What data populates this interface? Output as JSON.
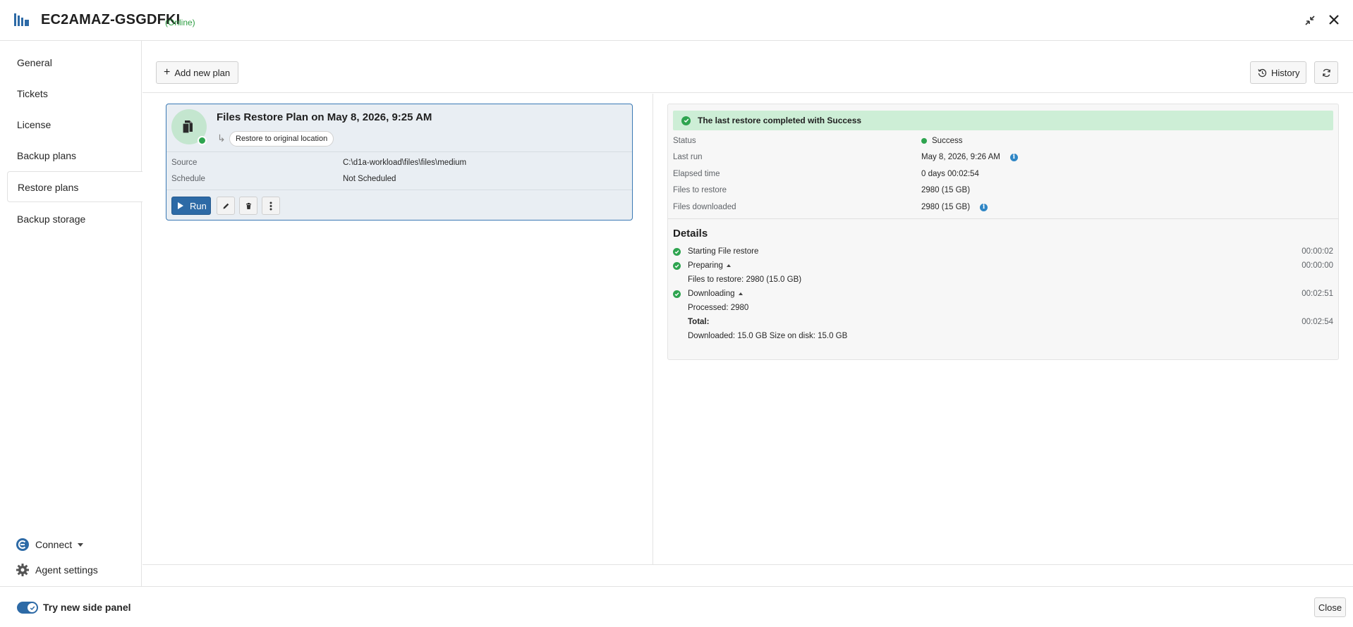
{
  "header": {
    "title": "EC2AMAZ-GSGDFKI",
    "status": "(Online)",
    "icons": [
      "app-logo-icon",
      "collapse-icon",
      "close-icon"
    ]
  },
  "sidebar": {
    "items": [
      {
        "label": "General"
      },
      {
        "label": "Tickets"
      },
      {
        "label": "License"
      },
      {
        "label": "Backup plans"
      },
      {
        "label": "Restore plans",
        "active": true
      },
      {
        "label": "Backup storage"
      }
    ],
    "connect_label": "Connect",
    "agent_settings_label": "Agent settings"
  },
  "toolbar": {
    "add_plan_label": "Add new plan",
    "history_label": "History"
  },
  "plan": {
    "name": "Files Restore Plan on May 8, 2026, 9:25 AM",
    "destination": "Restore to original location",
    "source_label": "Source",
    "source_value": "C:\\d1a-workload\\files\\files\\medium",
    "schedule_label": "Schedule",
    "schedule_value": "Not Scheduled",
    "run_label": "Run"
  },
  "result": {
    "banner": "The last restore completed with Success",
    "status_label": "Status",
    "status_value": "Success",
    "last_run_label": "Last run",
    "last_run_value": "May 8, 2026, 9:26 AM",
    "elapsed_label": "Elapsed time",
    "elapsed_value": "0 days 00:02:54",
    "files_to_restore_label": "Files to restore",
    "files_to_restore_value": "2980 (15 GB)",
    "files_downloaded_label": "Files downloaded",
    "files_downloaded_value": "2980 (15 GB)",
    "details_heading": "Details",
    "steps": [
      {
        "label": "Starting File restore",
        "time": "00:00:02"
      },
      {
        "label": "Preparing",
        "time": "00:00:00",
        "sub": "Files to restore: 2980 (15.0 GB)"
      },
      {
        "label": "Downloading",
        "time": "00:02:51",
        "sub": "Processed: 2980"
      }
    ],
    "total_label": "Total:",
    "total_time": "00:02:54",
    "total_sub": "Downloaded: 15.0 GB Size on disk: 15.0 GB"
  },
  "footer": {
    "toggle_label": "Try new side panel",
    "toggle_on": true,
    "close_label": "Close"
  },
  "colors": {
    "accent": "#2d6aa6",
    "success": "#2ea44f",
    "success_bg": "#cdeed6",
    "online": "#2e9e43"
  }
}
